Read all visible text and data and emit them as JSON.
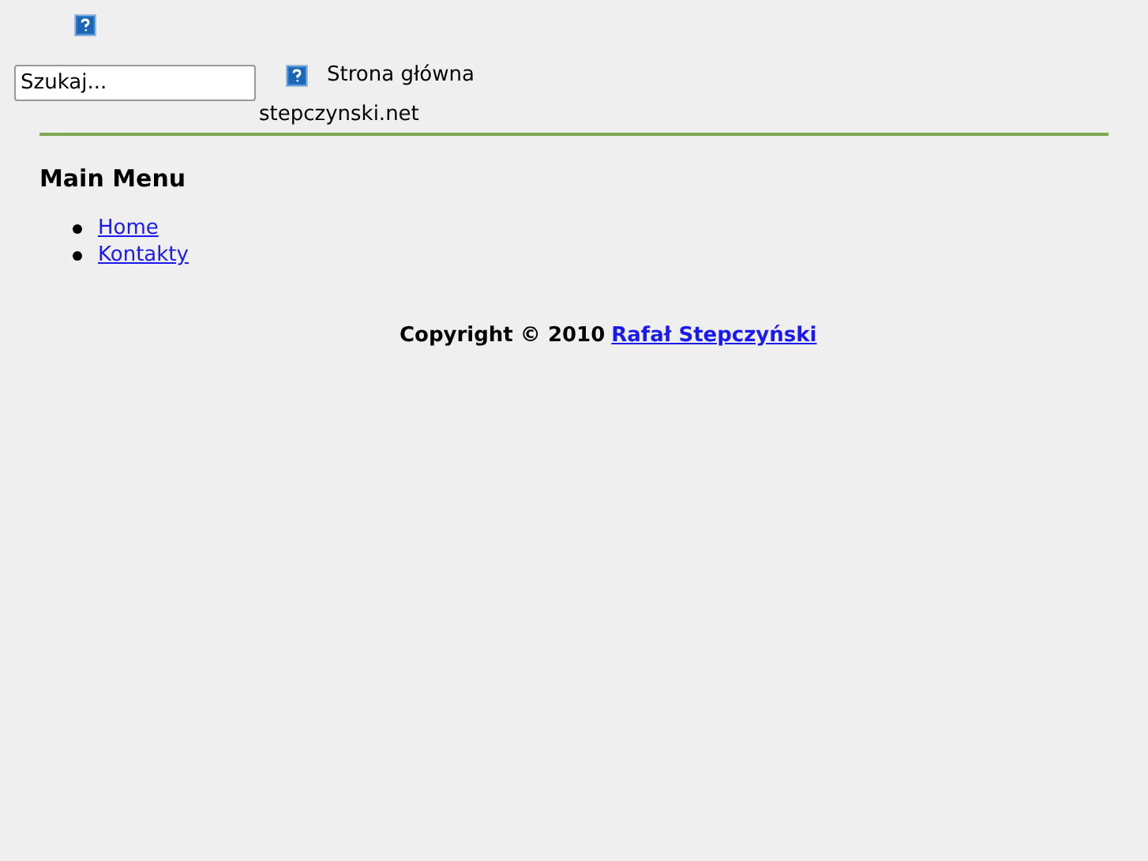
{
  "search": {
    "placeholder": "Szukaj..."
  },
  "header_link": "Strona główna",
  "site_name": "stepczynski.net",
  "main_menu": {
    "title": "Main Menu",
    "items": [
      {
        "label": "Home"
      },
      {
        "label": "Kontakty"
      }
    ]
  },
  "footer": {
    "copyright": "Copyright © 2010",
    "author_link": "Rafał Stepczyński"
  }
}
